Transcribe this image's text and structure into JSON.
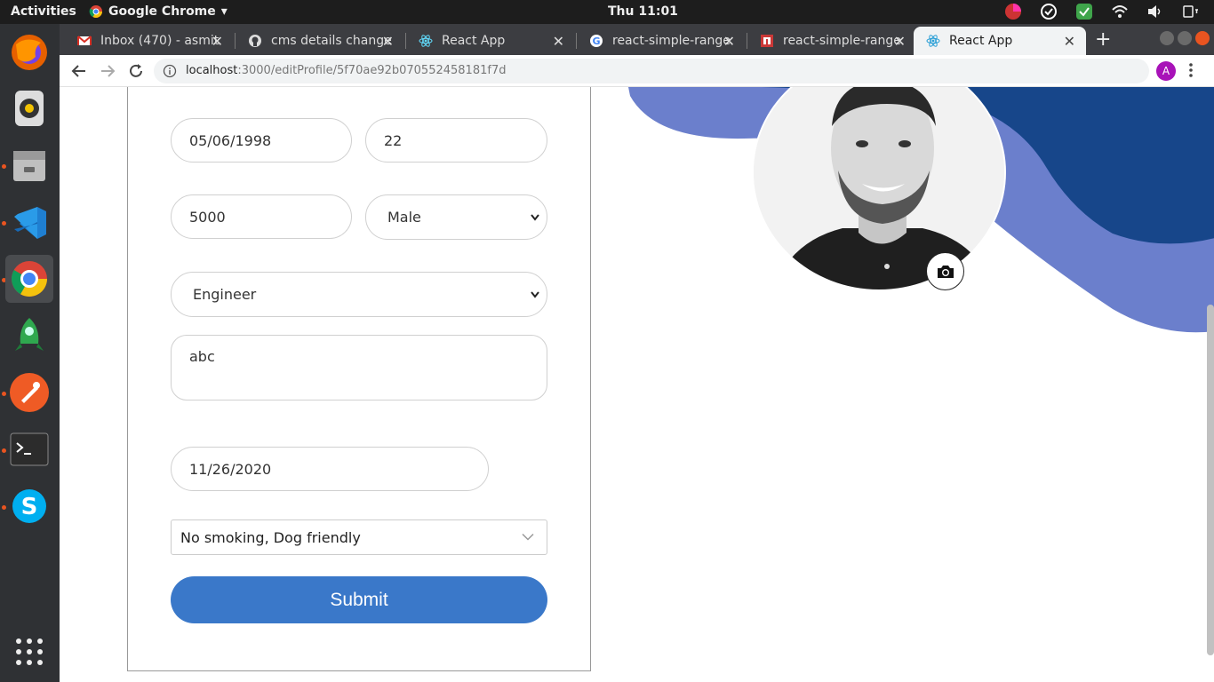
{
  "topbar": {
    "activities": "Activities",
    "app_name": "Google Chrome",
    "clock": "Thu 11:01"
  },
  "tabs": [
    {
      "label": "Inbox (470) - asmit",
      "favicon": "gmail-icon"
    },
    {
      "label": "cms details change",
      "favicon": "github-icon"
    },
    {
      "label": "React App",
      "favicon": "react-icon"
    },
    {
      "label": "react-simple-range",
      "favicon": "google-icon"
    },
    {
      "label": "react-simple-range",
      "favicon": "npm-icon"
    },
    {
      "label": "React App",
      "favicon": "react-icon",
      "active": true
    }
  ],
  "address": {
    "host": "localhost",
    "path": ":3000/editProfile/5f70ae92b070552458181f7d"
  },
  "profile_initial": "A",
  "form": {
    "dob": "05/06/1998",
    "age": "22",
    "salary": "5000",
    "gender": "Male",
    "profession": "Engineer",
    "about": "abc",
    "date": "11/26/2020",
    "preferences": "No smoking, Dog friendly",
    "submit_label": "Submit"
  },
  "colors": {
    "accent": "#3a78c9",
    "wave_dark": "#17468a",
    "wave_light": "#6b7fcc"
  }
}
